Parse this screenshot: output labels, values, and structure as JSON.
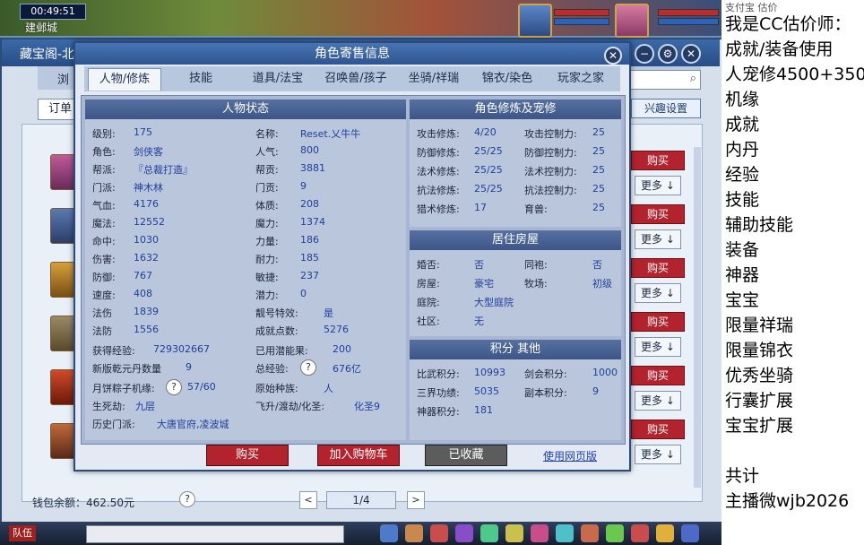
{
  "hud": {
    "clock": "00:49:51",
    "location": "建邺城"
  },
  "market": {
    "title": "藏宝阁-北",
    "tab_browse": "浏",
    "order_button": "订单",
    "interest_button": "兴趣设置",
    "buy_label": "购买",
    "more_label": "更多",
    "wallet_label": "钱包余额：",
    "wallet_value": "462.50元",
    "page": "1/4"
  },
  "popup": {
    "title": "角色寄售信息",
    "tabs": [
      "人物/修炼",
      "技能",
      "道具/法宝",
      "召唤兽/孩子",
      "坐骑/祥瑞",
      "锦衣/染色",
      "玩家之家"
    ],
    "status_header": "人物状态",
    "cultivation_header": "角色修炼及宠修",
    "house_header": "居住房屋",
    "score_header": "积分 其他",
    "status_left": [
      {
        "label": "级别:",
        "value": "175"
      },
      {
        "label": "角色:",
        "value": "剑侠客"
      },
      {
        "label": "帮派:",
        "value": "『总裁打造』"
      },
      {
        "label": "门派:",
        "value": "神木林"
      },
      {
        "label": "气血:",
        "value": "4176"
      },
      {
        "label": "魔法:",
        "value": "12552"
      },
      {
        "label": "命中:",
        "value": "1030"
      },
      {
        "label": "伤害:",
        "value": "1632"
      },
      {
        "label": "防御:",
        "value": "767"
      },
      {
        "label": "速度:",
        "value": "408"
      },
      {
        "label": "法伤",
        "value": "1839"
      },
      {
        "label": "法防",
        "value": "1556"
      }
    ],
    "status_right": [
      {
        "label": "名称:",
        "value": "Reset.乂牛牛"
      },
      {
        "label": "人气:",
        "value": "800"
      },
      {
        "label": "帮贡:",
        "value": "3881"
      },
      {
        "label": "门贡:",
        "value": "9"
      },
      {
        "label": "体质:",
        "value": "208"
      },
      {
        "label": "魔力:",
        "value": "1374"
      },
      {
        "label": "力量:",
        "value": "186"
      },
      {
        "label": "耐力:",
        "value": "185"
      },
      {
        "label": "敏捷:",
        "value": "237"
      },
      {
        "label": "潜力:",
        "value": "0"
      },
      {
        "label": "靓号特效:",
        "value": "是"
      },
      {
        "label": "成就点数:",
        "value": "5276"
      }
    ],
    "exp_label": "获得经验:",
    "exp_value": "729302667",
    "potential_label": "已用潜能果:",
    "potential_value": "200",
    "qiankun_label": "新版乾元丹数量",
    "qiankun_value": "9",
    "total_exp_label": "总经验:",
    "total_exp_value": "676亿",
    "mooncake_label": "月饼粽子机缘:",
    "mooncake_value": "57/60",
    "origin_label": "原始种族:",
    "origin_value": "人",
    "life_label": "生死劫:",
    "life_value": "九层",
    "fly_label": "飞升/渡劫/化圣:",
    "fly_value": "化圣9",
    "history_label": "历史门派:",
    "history_value": "大唐官府,凌波城",
    "cultivation": [
      {
        "l1": "攻击修炼:",
        "v1": "4/20",
        "l2": "攻击控制力:",
        "v2": "25"
      },
      {
        "l1": "防御修炼:",
        "v1": "25/25",
        "l2": "防御控制力:",
        "v2": "25"
      },
      {
        "l1": "法术修炼:",
        "v1": "25/25",
        "l2": "法术控制力:",
        "v2": "25"
      },
      {
        "l1": "抗法修炼:",
        "v1": "25/25",
        "l2": "抗法控制力:",
        "v2": "25"
      },
      {
        "l1": "猎术修炼:",
        "v1": "17",
        "l2": "育兽:",
        "v2": "25"
      }
    ],
    "house": [
      {
        "l1": "婚否:",
        "v1": "否",
        "l2": "同袍:",
        "v2": "否"
      },
      {
        "l1": "房屋:",
        "v1": "豪宅",
        "l2": "牧场:",
        "v2": "初级"
      },
      {
        "l1": "庭院:",
        "v1": "大型庭院",
        "l2": "",
        "v2": ""
      },
      {
        "l1": "社区:",
        "v1": "无",
        "l2": "",
        "v2": ""
      }
    ],
    "scores": [
      {
        "l1": "比武积分:",
        "v1": "10993",
        "l2": "剑会积分:",
        "v2": "1000"
      },
      {
        "l1": "三界功绩:",
        "v1": "5035",
        "l2": "副本积分:",
        "v2": "9"
      },
      {
        "l1": "神器积分:",
        "v1": "181",
        "l2": "",
        "v2": ""
      }
    ],
    "buy_button": "购买",
    "cart_button": "加入购物车",
    "fav_button": "已收藏",
    "web_link": "使用网页版"
  },
  "right_panel": {
    "lines": [
      "我是CC估价师：",
      "成就/装备使用",
      "人宠修4500+350",
      "机缘",
      "成就",
      "内丹",
      "经验",
      "技能",
      "辅助技能",
      "装备",
      "神器",
      "宝宝",
      "限量祥瑞",
      "限量锦衣",
      "优秀坐骑",
      "行囊扩展",
      "宝宝扩展",
      "",
      "共计",
      "主播微wjb2026"
    ],
    "top_line": "支付宝 估价"
  },
  "bottom": {
    "team": "队伍"
  },
  "colors": {
    "accent": "#2e5590",
    "buy": "#b3232e"
  }
}
